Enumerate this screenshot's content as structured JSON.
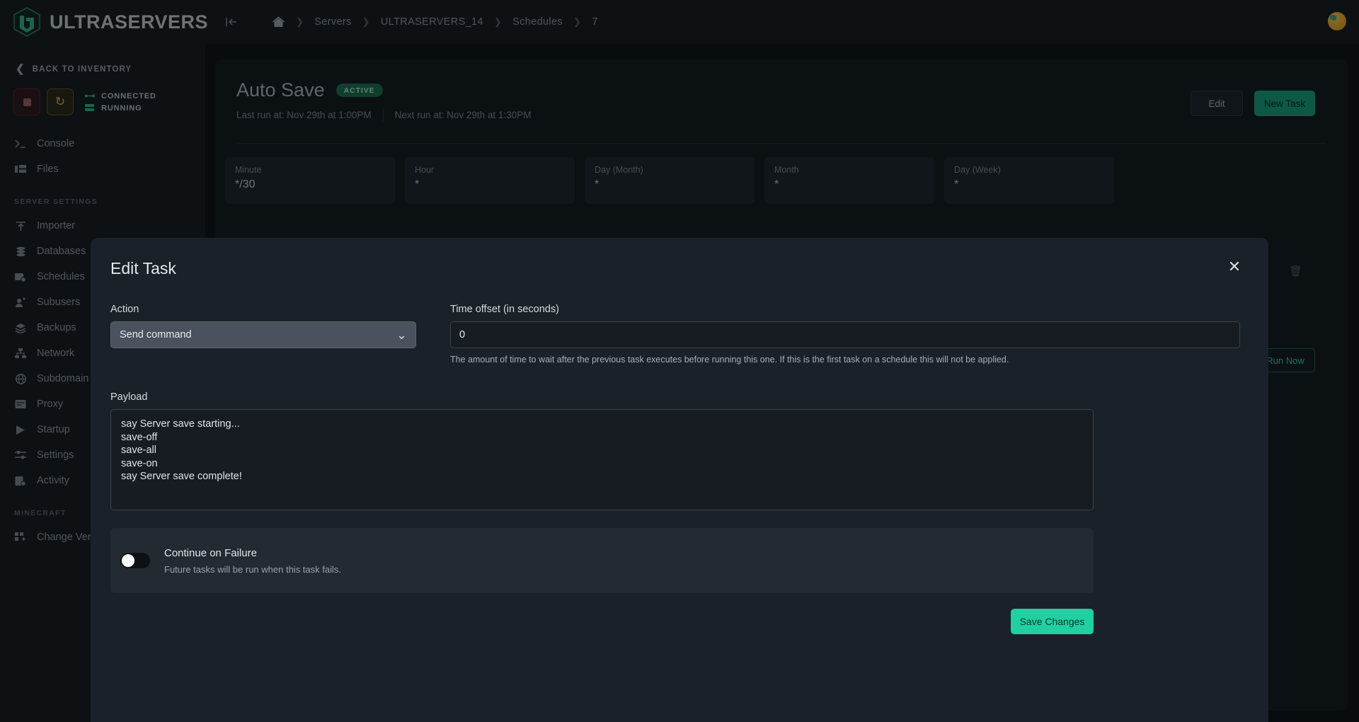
{
  "topbar": {
    "brand": "ULTRASERVERS",
    "logo_icon": "ultraservers-logo-icon",
    "collapse_icon": "collapse-sidebar-icon",
    "home_icon": "home-icon",
    "breadcrumb": [
      "Servers",
      "ULTRASERVERS_14",
      "Schedules",
      "7"
    ],
    "avatar_icon": "user-avatar"
  },
  "sidebar": {
    "back_label": "BACK TO INVENTORY",
    "back_icon": "chevron-left-icon",
    "power": {
      "stop_icon": "stop-square-icon",
      "restart_icon": "restart-arrows-icon",
      "connection_label": "CONNECTED",
      "connection_icon": "network-plug-icon",
      "state_label": "RUNNING",
      "state_icon": "server-stack-icon"
    },
    "items": [
      {
        "label": "Console",
        "icon": "terminal-icon"
      },
      {
        "label": "Files",
        "icon": "folder-icon"
      }
    ],
    "section_server": "SERVER SETTINGS",
    "server_items": [
      {
        "label": "Importer",
        "icon": "upload-icon"
      },
      {
        "label": "Databases",
        "icon": "database-icon"
      },
      {
        "label": "Schedules",
        "icon": "calendar-clock-icon"
      },
      {
        "label": "Subusers",
        "icon": "users-icon"
      },
      {
        "label": "Backups",
        "icon": "layers-icon"
      },
      {
        "label": "Network",
        "icon": "network-nodes-icon"
      },
      {
        "label": "Subdomain",
        "icon": "globe-icon"
      },
      {
        "label": "Proxy",
        "icon": "proxy-box-icon"
      },
      {
        "label": "Startup",
        "icon": "play-icon"
      },
      {
        "label": "Settings",
        "icon": "sliders-icon"
      },
      {
        "label": "Activity",
        "icon": "activity-log-icon"
      }
    ],
    "section_minecraft": "MINECRAFT",
    "minecraft_items": [
      {
        "label": "Change Version",
        "icon": "blocks-plus-icon"
      }
    ]
  },
  "page": {
    "title": "Auto Save",
    "status_badge": "ACTIVE",
    "last_run": "Last run at: Nov 29th at 1:00PM",
    "next_run": "Next run at: Nov 29th at 1:30PM",
    "edit_label": "Edit",
    "new_task_label": "New Task",
    "run_now_label": "Run Now",
    "edit_task_icon": "pencil-icon",
    "delete_task_icon": "trash-icon",
    "cron": [
      {
        "label": "Minute",
        "value": "*/30"
      },
      {
        "label": "Hour",
        "value": "*"
      },
      {
        "label": "Day (Month)",
        "value": "*"
      },
      {
        "label": "Month",
        "value": "*"
      },
      {
        "label": "Day (Week)",
        "value": "*"
      }
    ]
  },
  "modal": {
    "title": "Edit Task",
    "close_icon": "close-icon",
    "action_label": "Action",
    "action_value": "Send command",
    "action_chevron_icon": "chevron-down-icon",
    "offset_label": "Time offset (in seconds)",
    "offset_value": "0",
    "offset_placeholder": "0",
    "offset_help": "The amount of time to wait after the previous task executes before running this one. If this is the first task on a schedule this will not be applied.",
    "payload_label": "Payload",
    "payload_value": "say Server save starting...\nsave-off\nsave-all\nsave-on\nsay Server save complete!",
    "toggle_title": "Continue on Failure",
    "toggle_sub": "Future tasks will be run when this task fails.",
    "toggle_state": "off",
    "save_label": "Save Changes"
  },
  "colors": {
    "accent": "#1fd1a1",
    "accent_dark": "#159b77",
    "badge_bg": "#1b6b4c",
    "page_bg": "#0c1013",
    "panel_bg": "#14191d",
    "modal_bg": "#1b2128"
  }
}
